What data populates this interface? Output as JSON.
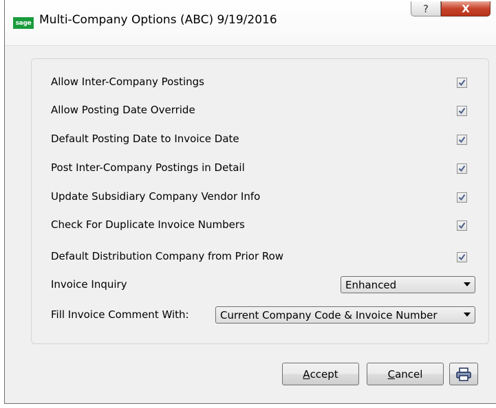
{
  "window": {
    "icon_text": "sage",
    "title": "Multi-Company Options (ABC) 9/19/2016",
    "help_glyph": "?",
    "close_glyph": "X"
  },
  "options": [
    {
      "label": "Allow Inter-Company Postings",
      "checked": true
    },
    {
      "label": "Allow Posting Date Override",
      "checked": true
    },
    {
      "label": "Default Posting Date to Invoice Date",
      "checked": true
    },
    {
      "label": "Post Inter-Company Postings in Detail",
      "checked": true
    },
    {
      "label": "Update Subsidiary Company Vendor Info",
      "checked": true
    },
    {
      "label": "Check For Duplicate Invoice Numbers",
      "checked": true
    },
    {
      "label": "Default Distribution Company from Prior Row",
      "checked": true
    }
  ],
  "invoice_inquiry": {
    "label": "Invoice Inquiry",
    "value": "Enhanced"
  },
  "fill_comment": {
    "label": "Fill Invoice Comment With:",
    "value": "Current Company Code & Invoice Number"
  },
  "buttons": {
    "accept_first": "A",
    "accept_rest": "ccept",
    "cancel_first": "C",
    "cancel_rest": "ancel"
  },
  "colors": {
    "close_red": "#c7432b",
    "sage_green": "#1a9b3c",
    "check_blue": "#4a5f8a"
  }
}
